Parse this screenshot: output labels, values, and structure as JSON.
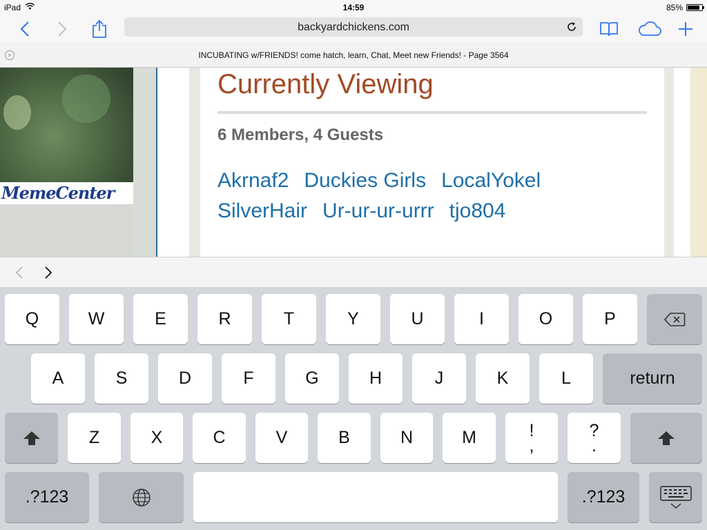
{
  "status_bar": {
    "device": "iPad",
    "time": "14:59",
    "battery_percent_label": "85%",
    "battery_level": 0.85,
    "wifi_icon": "wifi-icon"
  },
  "toolbar": {
    "url": "backyardchickens.com",
    "icons": {
      "back": "chevron-left-icon",
      "forward": "chevron-right-icon",
      "share": "share-icon",
      "reload": "reload-icon",
      "bookmarks": "book-icon",
      "icloud": "cloud-icon",
      "new_tab": "plus-icon"
    },
    "accent_color": "#3478f6"
  },
  "tab": {
    "title": "INCUBATING w/FRIENDS! come hatch, learn, Chat, Meet new Friends! - Page 3564"
  },
  "page": {
    "meme_logo": "MemeCenter",
    "currently_viewing": {
      "title": "Currently Viewing",
      "count": "6 Members, 4 Guests",
      "members": [
        "Akrnaf2",
        "Duckies Girls",
        "LocalYokel",
        "SilverHair",
        "Ur-ur-ur-urrr",
        "tjo804"
      ]
    },
    "colors": {
      "title": "#a24a26",
      "link": "#1e6fa8"
    }
  },
  "accessory_bar": {
    "prev_icon": "chevron-left-icon",
    "next_icon": "chevron-right-icon"
  },
  "keyboard": {
    "row1": [
      "Q",
      "W",
      "E",
      "R",
      "T",
      "Y",
      "U",
      "I",
      "O",
      "P"
    ],
    "row2": [
      "A",
      "S",
      "D",
      "F",
      "G",
      "H",
      "J",
      "K",
      "L"
    ],
    "row3": [
      "Z",
      "X",
      "C",
      "V",
      "B",
      "N",
      "M"
    ],
    "punct1": {
      "top": "!",
      "bottom": ","
    },
    "punct2": {
      "top": "?",
      "bottom": "."
    },
    "return_label": "return",
    "numbers_label": ".?123",
    "icons": {
      "delete": "delete-icon",
      "shift": "shift-icon",
      "globe": "globe-icon",
      "dismiss": "keyboard-dismiss-icon"
    }
  }
}
